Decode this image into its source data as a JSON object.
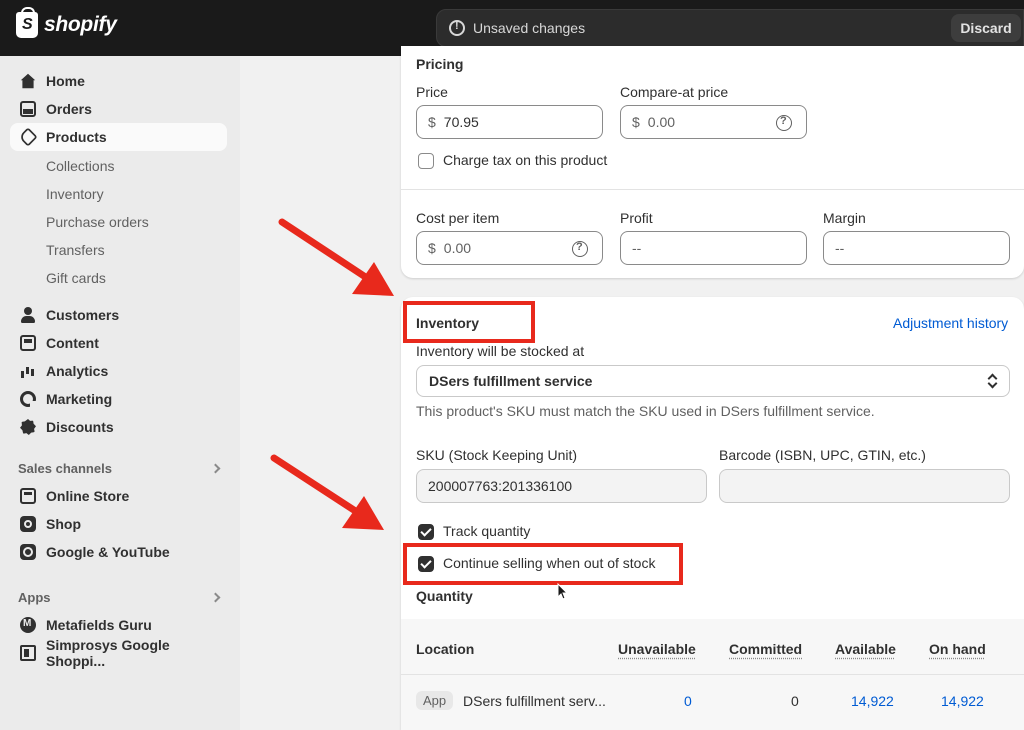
{
  "topbar": {
    "logo_text": "shopify",
    "unsaved_text": "Unsaved changes",
    "discard_label": "Discard"
  },
  "sidebar": {
    "items": [
      {
        "label": "Home",
        "icon": "home-icon"
      },
      {
        "label": "Orders",
        "icon": "orders-icon"
      },
      {
        "label": "Products",
        "icon": "products-icon"
      }
    ],
    "product_subitems": [
      "Collections",
      "Inventory",
      "Purchase orders",
      "Transfers",
      "Gift cards"
    ],
    "items2": [
      {
        "label": "Customers",
        "icon": "customers-icon"
      },
      {
        "label": "Content",
        "icon": "content-icon"
      },
      {
        "label": "Analytics",
        "icon": "analytics-icon"
      },
      {
        "label": "Marketing",
        "icon": "marketing-icon"
      },
      {
        "label": "Discounts",
        "icon": "discounts-icon"
      }
    ],
    "sales_channels_label": "Sales channels",
    "channels": [
      {
        "label": "Online Store",
        "icon": "online-store-icon"
      },
      {
        "label": "Shop",
        "icon": "shop-icon"
      },
      {
        "label": "Google & YouTube",
        "icon": "google-icon"
      }
    ],
    "apps_label": "Apps",
    "apps": [
      {
        "label": "Metafields Guru",
        "icon": "metafields-icon"
      },
      {
        "label": "Simprosys Google Shoppi...",
        "icon": "simprosys-icon"
      }
    ]
  },
  "pricing": {
    "title": "Pricing",
    "price_label": "Price",
    "price_prefix": "$",
    "price_value": "70.95",
    "compare_label": "Compare-at price",
    "compare_prefix": "$",
    "compare_value": "0.00",
    "charge_tax_label": "Charge tax on this product",
    "cost_label": "Cost per item",
    "cost_prefix": "$",
    "cost_value": "0.00",
    "profit_label": "Profit",
    "profit_value": "--",
    "margin_label": "Margin",
    "margin_value": "--"
  },
  "inventory": {
    "title": "Inventory",
    "adjustment_history": "Adjustment history",
    "stocked_at_label": "Inventory will be stocked at",
    "stocked_at_value": "DSers fulfillment service",
    "sku_help": "This product's SKU must match the SKU used in DSers fulfillment service.",
    "sku_label": "SKU (Stock Keeping Unit)",
    "sku_value": "200007763:201336100",
    "barcode_label": "Barcode (ISBN, UPC, GTIN, etc.)",
    "barcode_value": "",
    "track_quantity_label": "Track quantity",
    "continue_selling_label": "Continue selling when out of stock",
    "quantity_title": "Quantity",
    "table": {
      "headers": [
        "Location",
        "Unavailable",
        "Committed",
        "Available",
        "On hand"
      ],
      "row": {
        "badge": "App",
        "location": "DSers fulfillment serv...",
        "unavailable": "0",
        "committed": "0",
        "available": "14,922",
        "on_hand": "14,922"
      }
    }
  },
  "colors": {
    "annotation_red": "#e8291c",
    "link_blue": "#005bd3",
    "topbar": "#1a1a1a"
  }
}
